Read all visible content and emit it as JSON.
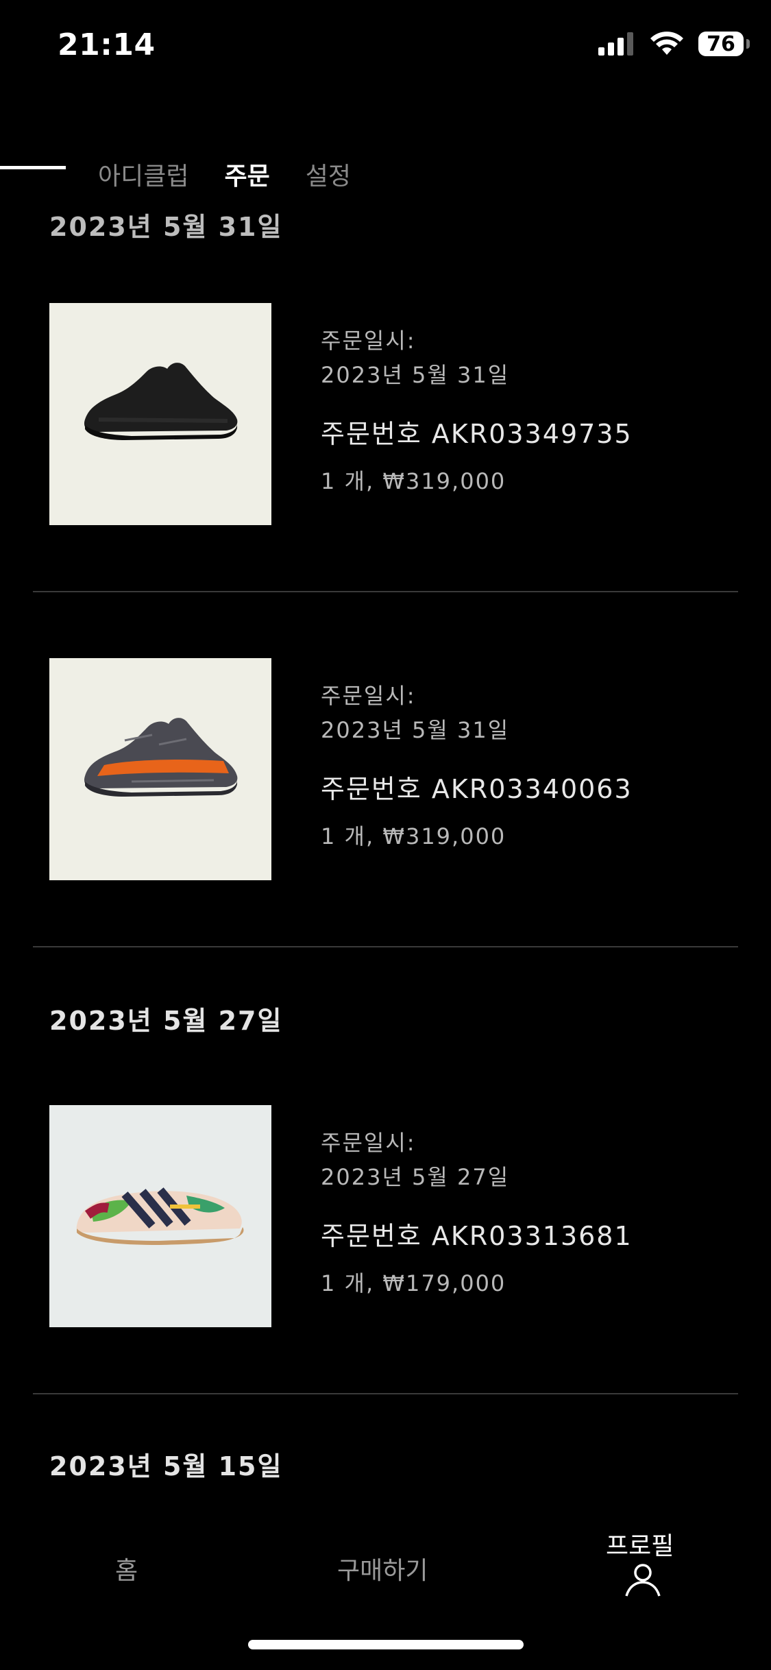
{
  "status_bar": {
    "time": "21:14",
    "battery": "76"
  },
  "tabs": [
    {
      "label": "아디클럽"
    },
    {
      "label": "주문"
    },
    {
      "label": "설정"
    }
  ],
  "partial_date_header": "2023년 5월 31일",
  "orders": [
    {
      "date_label": "주문일시:",
      "date": "2023년 5월 31일",
      "order_number": "주문번호 AKR03349735",
      "summary": "1 개, ₩319,000"
    },
    {
      "date_label": "주문일시:",
      "date": "2023년 5월 31일",
      "order_number": "주문번호 AKR03340063",
      "summary": "1 개, ₩319,000"
    },
    {
      "date_label": "주문일시:",
      "date": "2023년 5월 27일",
      "order_number": "주문번호 AKR03313681",
      "summary": "1 개, ₩179,000"
    }
  ],
  "date_headers": [
    "2023년 5월 27일",
    "2023년 5월 15일"
  ],
  "nav": {
    "home": "홈",
    "shop": "구매하기",
    "profile": "프로필"
  },
  "colors": {
    "background": "#000000",
    "thumb_cream": "#efefe6",
    "thumb_gray": "#e8eceb",
    "accent_orange": "#e8641a"
  }
}
